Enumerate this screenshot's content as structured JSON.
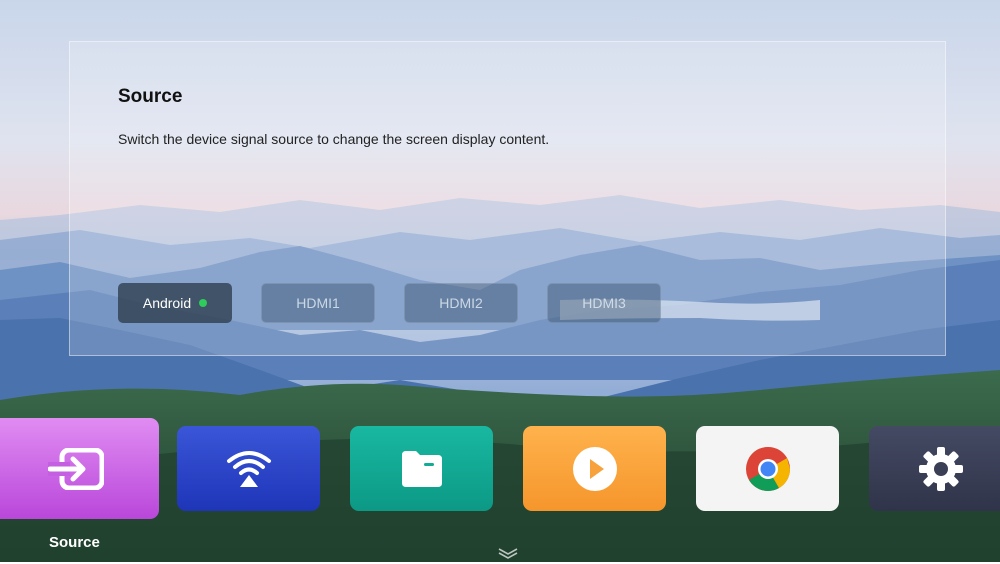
{
  "panel": {
    "title": "Source",
    "description": "Switch the device signal source to change the screen display content."
  },
  "sources": [
    {
      "label": "Android",
      "active": true
    },
    {
      "label": "HDMI1",
      "active": false
    },
    {
      "label": "HDMI2",
      "active": false
    },
    {
      "label": "HDMI3",
      "active": false
    }
  ],
  "apps": [
    {
      "icon": "source-input-icon",
      "color": "#c64fe0",
      "label": "Source",
      "focused": true
    },
    {
      "icon": "screen-cast-icon",
      "color": "#2a44c8"
    },
    {
      "icon": "file-manager-icon",
      "color": "#12ab96"
    },
    {
      "icon": "video-player-icon",
      "color": "#f7a23c"
    },
    {
      "icon": "chrome-icon",
      "color": "#f4f4f4"
    },
    {
      "icon": "settings-gear-icon",
      "color": "#3a3f55"
    }
  ],
  "colors": {
    "active_dot": "#2ecc5a"
  }
}
